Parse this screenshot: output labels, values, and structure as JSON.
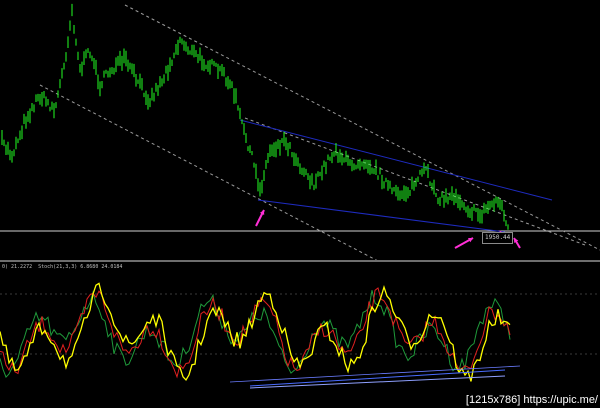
{
  "price_panel": {
    "current_price_label": "1950.44",
    "colors": {
      "candle_up": "#22ff22",
      "channel_dotted": "#9a9a9a",
      "wedge_lines": "#1e2bbf",
      "arrow": "#ff2fd6",
      "level_line": "#cfcfcf"
    },
    "arrows_count": 4
  },
  "indicator_panel": {
    "label_main": "0) 21.2272",
    "label_stoch": "Stoch(21,3,3) 6.8680 24.0184",
    "colors": {
      "signal_yellow": "#ffff00",
      "line_red": "#e02020",
      "line_green": "#1f9a3a",
      "trendline_blue": "#4a6cff",
      "separator": "#6e6e6e"
    }
  },
  "watermark": "[1215x786] https://upic.me/"
}
